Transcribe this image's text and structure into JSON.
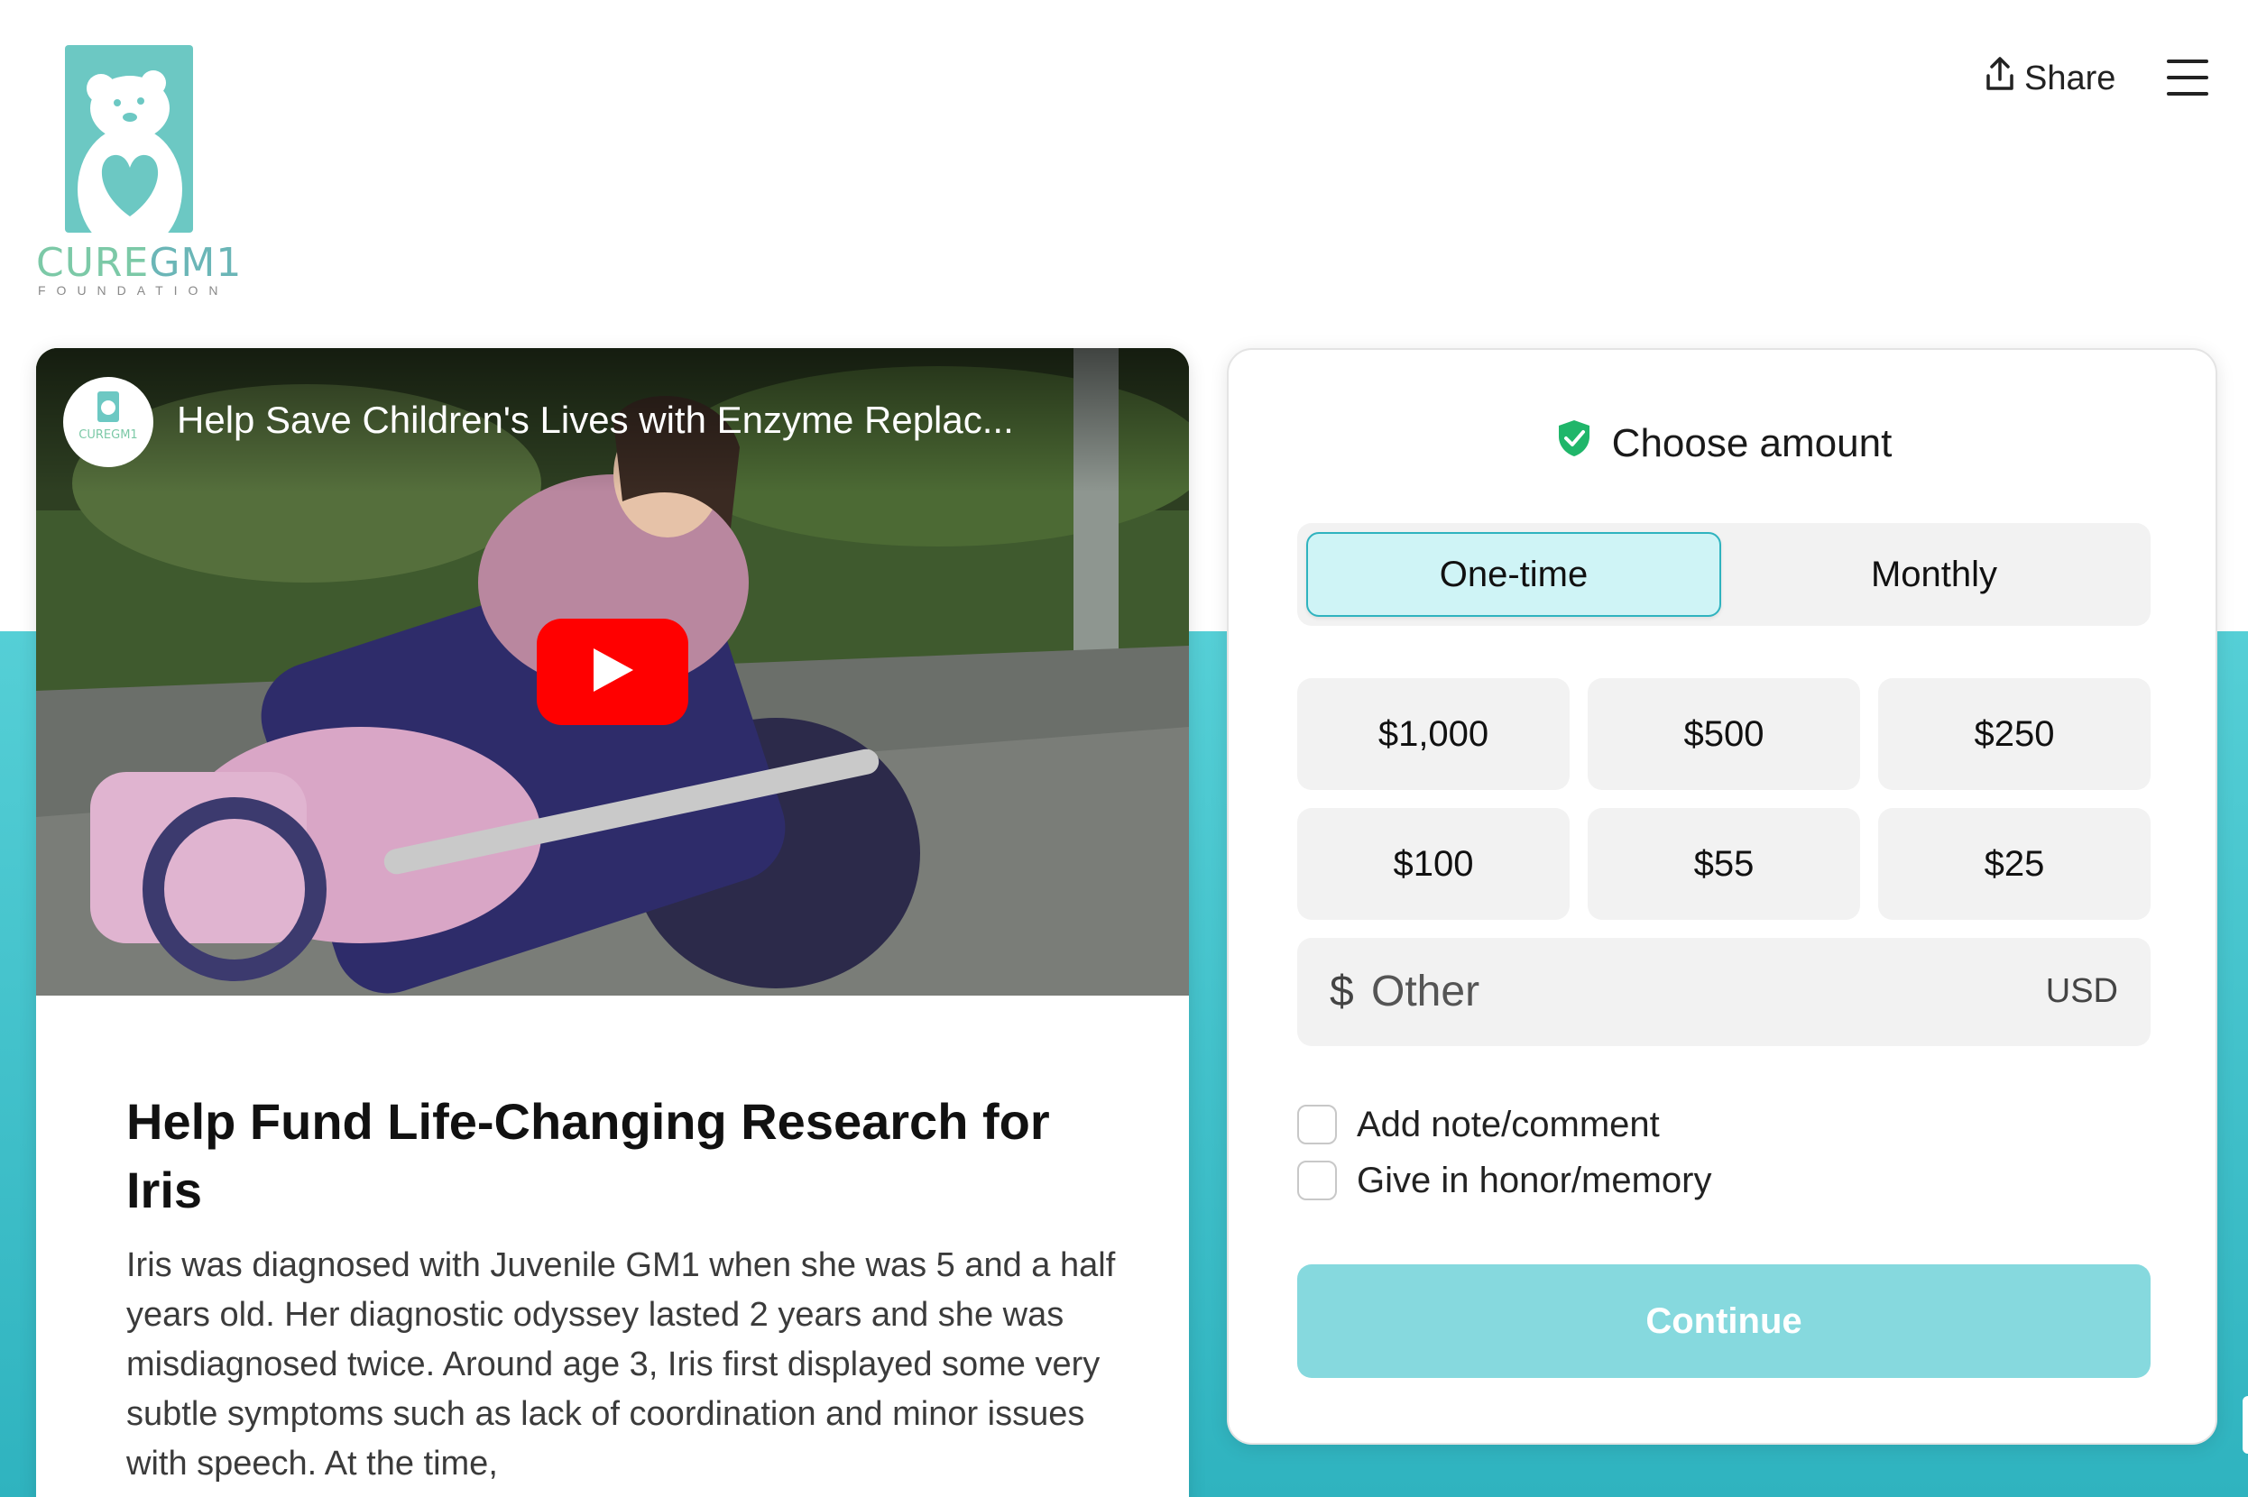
{
  "header": {
    "logo_text_cure": "CURE",
    "logo_text_gm": "GM1",
    "logo_sub": "FOUNDATION",
    "share_label": "Share"
  },
  "video": {
    "title": "Help Save Children's Lives with Enzyme Replac...",
    "channel_avatar_text": "CUREGM1",
    "play_icon": "play-icon"
  },
  "story": {
    "title": "Help Fund Life-Changing Research for Iris",
    "body": "Iris was diagnosed with Juvenile GM1 when she was 5 and a half years old. Her diagnostic odyssey lasted 2 years and she was misdiagnosed twice. Around age 3, Iris first displayed some very subtle symptoms such as lack of coordination and minor issues with speech. At the time,"
  },
  "donation": {
    "heading": "Choose amount",
    "heading_icon": "shield-check-icon",
    "frequency": {
      "options": [
        "One-time",
        "Monthly"
      ],
      "selected": "One-time"
    },
    "amounts": [
      "$1,000",
      "$500",
      "$250",
      "$100",
      "$55",
      "$25"
    ],
    "other": {
      "currency_symbol": "$",
      "placeholder": "Other",
      "currency": "USD"
    },
    "checkboxes": [
      "Add note/comment",
      "Give in honor/memory"
    ],
    "continue_label": "Continue"
  },
  "colors": {
    "accent": "#2fb3bf",
    "band_top": "#55cfd6",
    "selected_bg": "#cff4f6",
    "continue_bg": "#86d9de",
    "youtube_red": "#ff0000",
    "shield_green": "#20b66a"
  }
}
